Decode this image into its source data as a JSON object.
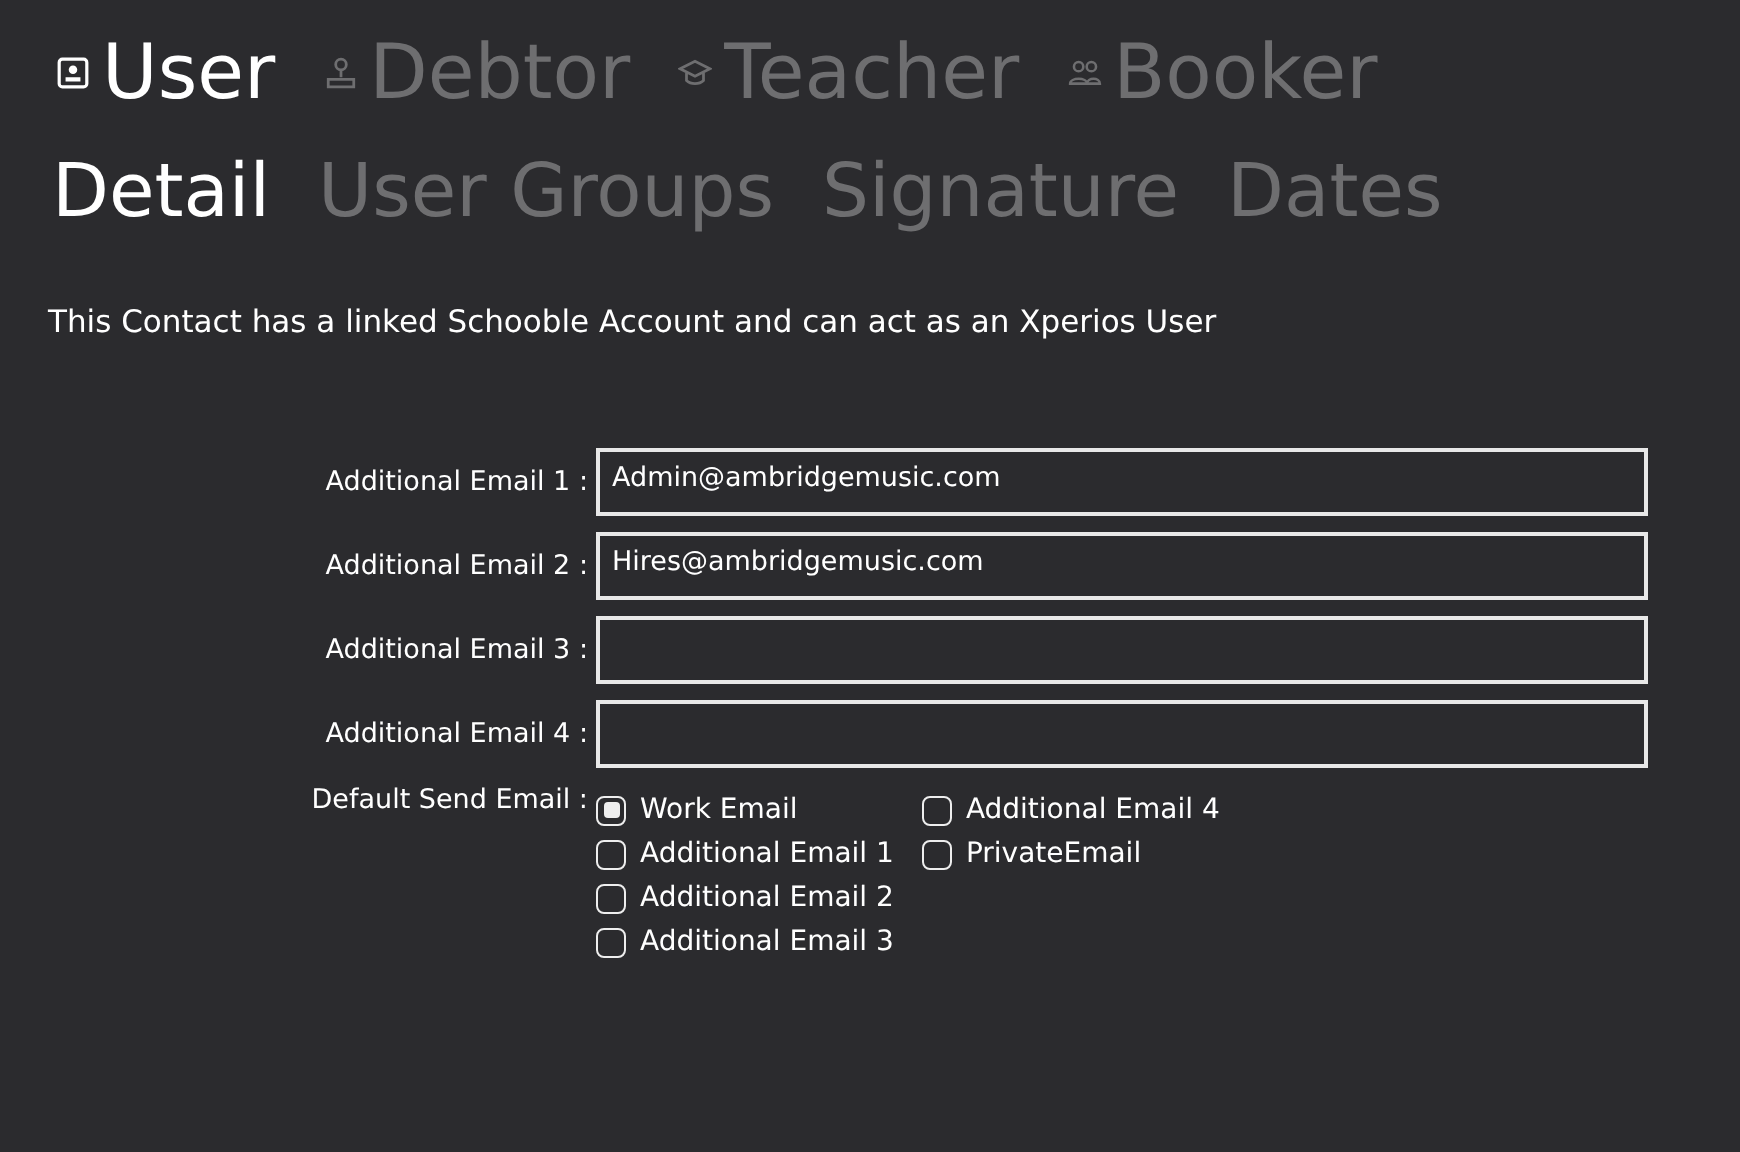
{
  "main_tabs": [
    {
      "label": "User",
      "kind": "id-card",
      "selected": true
    },
    {
      "label": "Debtor",
      "kind": "person",
      "selected": false
    },
    {
      "label": "Teacher",
      "kind": "mortarboard",
      "selected": false
    },
    {
      "label": "Booker",
      "kind": "people",
      "selected": false
    }
  ],
  "sub_tabs": [
    {
      "label": "Detail",
      "selected": true
    },
    {
      "label": "User Groups",
      "selected": false
    },
    {
      "label": "Signature",
      "selected": false
    },
    {
      "label": "Dates",
      "selected": false
    }
  ],
  "info_text": "This Contact has a linked Schooble Account and can act as an Xperios User",
  "fields": [
    {
      "label": "Additional Email 1 :",
      "value": "Admin@ambridgemusic.com"
    },
    {
      "label": "Additional Email 2 :",
      "value": "Hires@ambridgemusic.com"
    },
    {
      "label": "Additional Email 3 :"
    },
    {
      "label": "Additional Email 4 :"
    }
  ],
  "default_send": {
    "label": "Default Send Email :",
    "options": [
      {
        "label": "Work Email",
        "selected": true
      },
      {
        "label": "Additional Email 1",
        "selected": false
      },
      {
        "label": "Additional Email 2",
        "selected": false
      },
      {
        "label": "Additional Email 3",
        "selected": false
      },
      {
        "label": "Additional Email 4",
        "selected": false
      },
      {
        "label": "PrivateEmail",
        "selected": false
      }
    ]
  }
}
